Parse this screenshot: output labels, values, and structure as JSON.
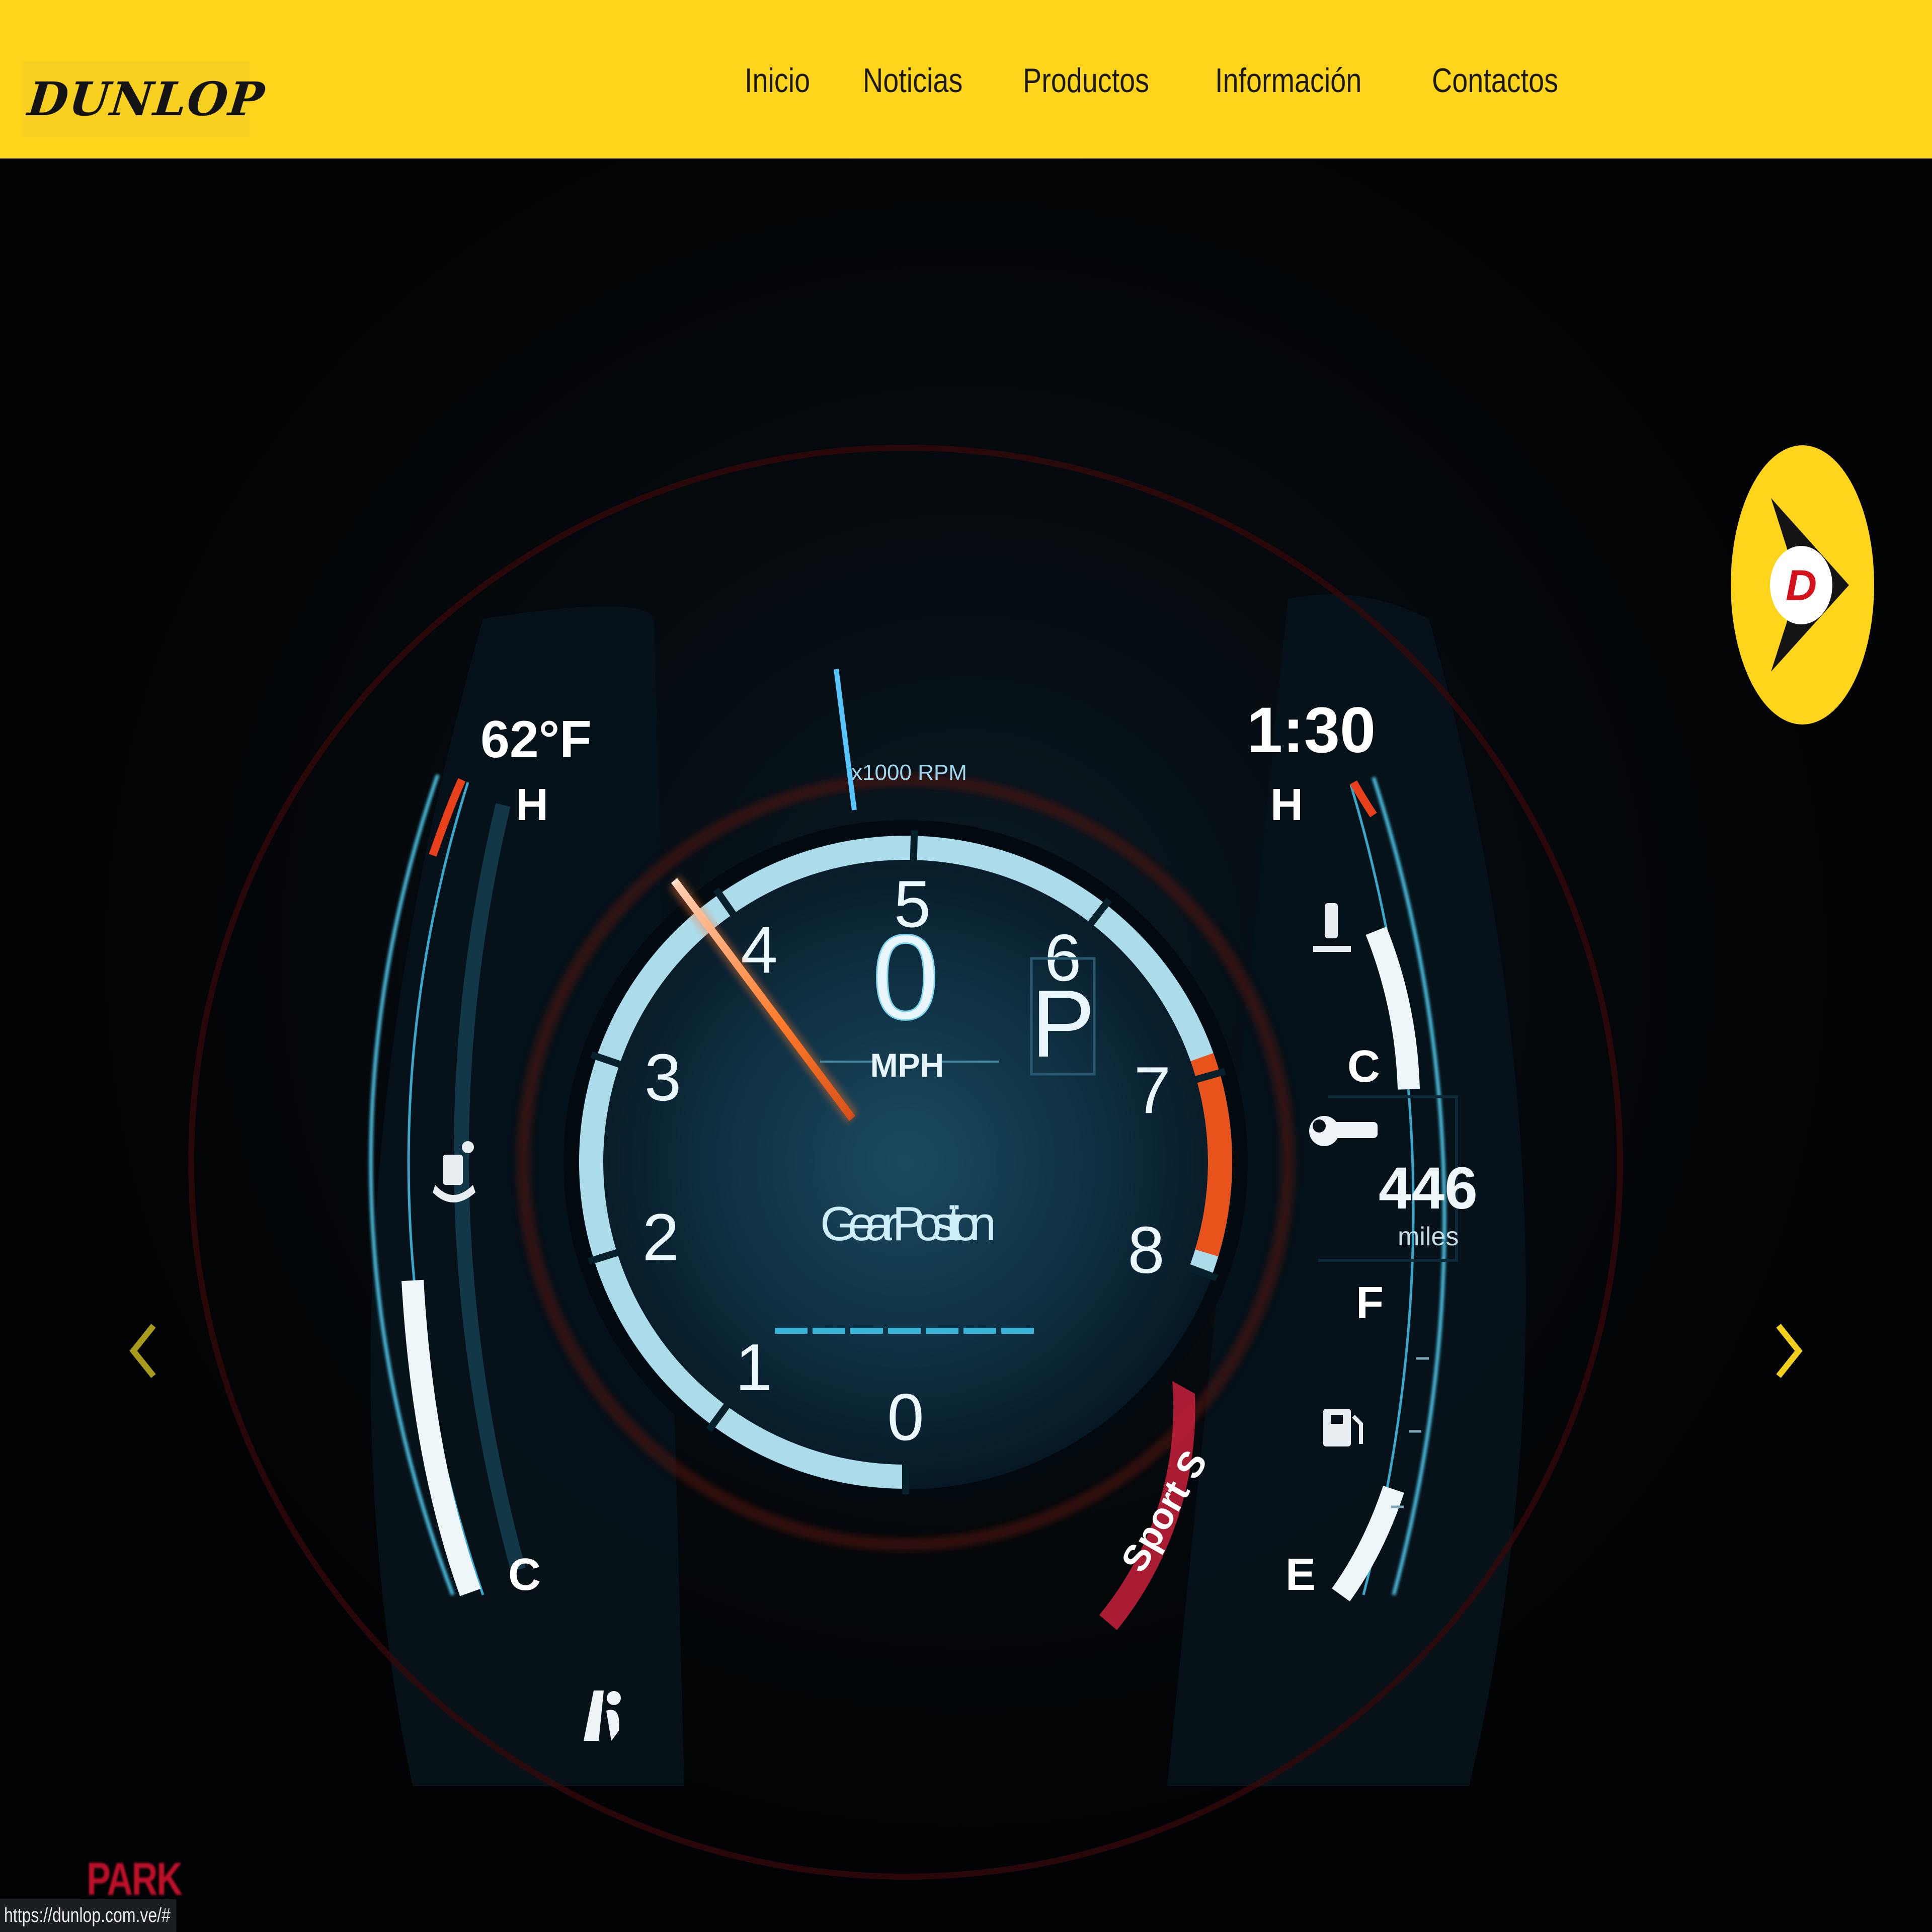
{
  "header": {
    "logo_text": "DUNLOP",
    "nav": [
      {
        "label": "Inicio"
      },
      {
        "label": "Noticias"
      },
      {
        "label": "Productos"
      },
      {
        "label": "Información"
      },
      {
        "label": "Contactos"
      }
    ]
  },
  "hero": {
    "gauge": {
      "tick_labels": [
        "0",
        "1",
        "2",
        "3",
        "4",
        "5",
        "6",
        "7",
        "8"
      ],
      "rpm_unit": "x1000 RPM",
      "speed": "0",
      "speed_unit": "MPH",
      "gear": "P",
      "gear_label": "Gear Position",
      "sport_label": "Sport S"
    },
    "left_gauge": {
      "temperature": "62°F",
      "hot_label": "H",
      "cold_label": "C"
    },
    "right_gauge": {
      "clock": "1:30",
      "hot_label": "H",
      "cold_label": "C",
      "range_value": "446",
      "range_unit": "miles",
      "fuel_full_label": "F",
      "fuel_empty_label": "E"
    },
    "park_label": "PARK",
    "prev_icon": "chevron-left-icon",
    "next_icon": "chevron-right-icon"
  },
  "status_url": "https://dunlop.com.ve/#",
  "colors": {
    "brand_yellow": "#ffd51c",
    "gauge_cyan": "#7fe6ff",
    "needle_orange": "#ff6a1a",
    "redline": "#e8531c",
    "park_red": "#d0122c"
  }
}
